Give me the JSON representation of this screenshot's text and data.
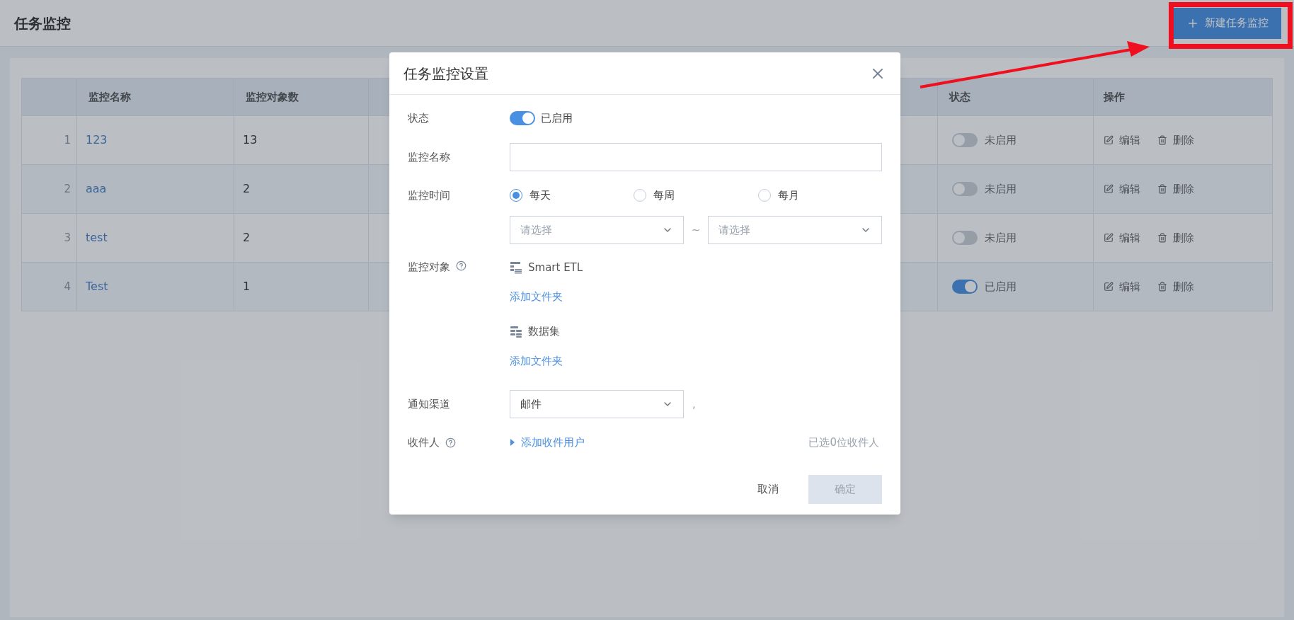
{
  "page": {
    "title": "任务监控",
    "new_button": "新建任务监控"
  },
  "table": {
    "columns": [
      "监控名称",
      "监控对象数",
      "状态",
      "操作"
    ],
    "rows": [
      {
        "index": "1",
        "name": "123",
        "count": "13",
        "enabled": false,
        "status": "未启用",
        "edit": "编辑",
        "delete": "删除"
      },
      {
        "index": "2",
        "name": "aaa",
        "count": "2",
        "enabled": false,
        "status": "未启用",
        "edit": "编辑",
        "delete": "删除"
      },
      {
        "index": "3",
        "name": "test",
        "count": "2",
        "enabled": false,
        "status": "未启用",
        "edit": "编辑",
        "delete": "删除"
      },
      {
        "index": "4",
        "name": "Test",
        "count": "1",
        "enabled": true,
        "status": "已启用",
        "edit": "编辑",
        "delete": "删除"
      }
    ]
  },
  "dialog": {
    "title": "任务监控设置",
    "status": {
      "label": "状态",
      "on": true,
      "text": "已启用"
    },
    "name": {
      "label": "监控名称"
    },
    "time": {
      "label": "监控时间",
      "options": [
        {
          "label": "每天",
          "selected": true
        },
        {
          "label": "每周",
          "selected": false
        },
        {
          "label": "每月",
          "selected": false
        }
      ],
      "from": {
        "placeholder": "请选择"
      },
      "separator": "~",
      "to": {
        "placeholder": "请选择"
      }
    },
    "objects": {
      "label": "监控对象",
      "groups": [
        {
          "kind": "etl",
          "name": "Smart ETL",
          "add": "添加文件夹"
        },
        {
          "kind": "dataset",
          "name": "数据集",
          "add": "添加文件夹"
        }
      ]
    },
    "channel": {
      "label": "通知渠道",
      "value": "邮件",
      "suffix": ","
    },
    "recipients": {
      "label": "收件人",
      "add": "添加收件用户",
      "count": "已选0位收件人"
    },
    "cancel": "取消",
    "confirm": "确定"
  }
}
